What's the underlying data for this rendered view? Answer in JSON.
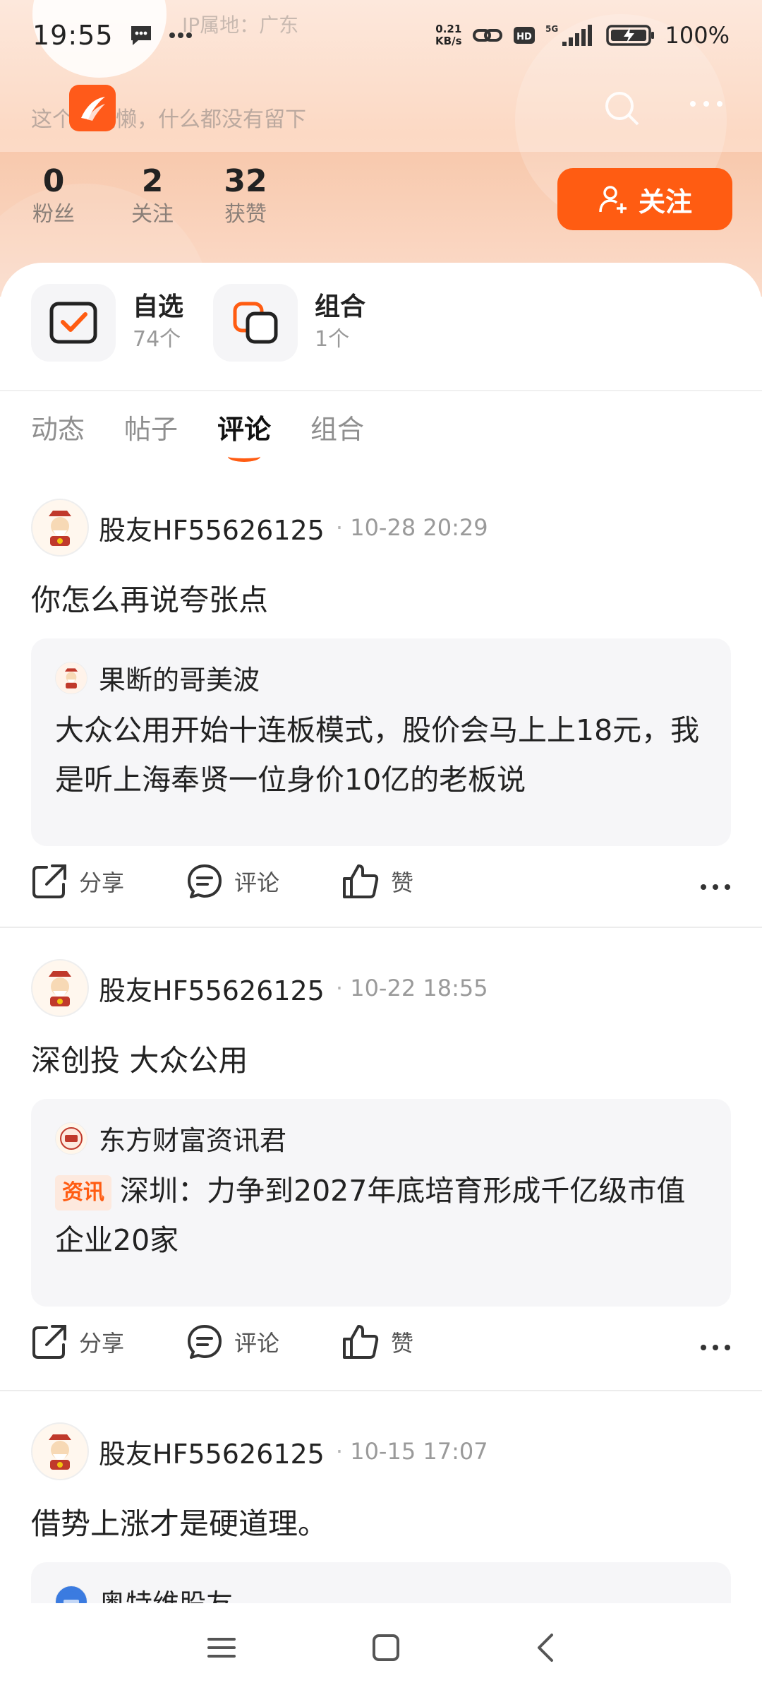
{
  "status_bar": {
    "time": "19:55",
    "net_speed_value": "0.21",
    "net_speed_unit": "KB/s",
    "battery": "100%"
  },
  "profile": {
    "ip_location": "IP属地：广东",
    "bio": "这个人很懒，什么都没有留下",
    "stats": [
      {
        "num": "0",
        "label": "粉丝"
      },
      {
        "num": "2",
        "label": "关注"
      },
      {
        "num": "32",
        "label": "获赞"
      }
    ],
    "follow_label": "关注"
  },
  "shortcuts": [
    {
      "title": "自选",
      "sub": "74个"
    },
    {
      "title": "组合",
      "sub": "1个"
    }
  ],
  "tabs": [
    {
      "label": "动态",
      "active": false
    },
    {
      "label": "帖子",
      "active": false
    },
    {
      "label": "评论",
      "active": true
    },
    {
      "label": "组合",
      "active": false
    }
  ],
  "actions": {
    "share": "分享",
    "comment": "评论",
    "like": "赞"
  },
  "posts": [
    {
      "author": "股友HF55626125",
      "time": "10-28 20:29",
      "text": "你怎么再说夸张点",
      "quote_author": "果断的哥美波",
      "quote_body": "大众公用开始十连板模式，股价会马上上18元，我是听上海奉贤一位身价10亿的老板说"
    },
    {
      "author": "股友HF55626125",
      "time": "10-22 18:55",
      "text": "深创投 大众公用",
      "quote_author": "东方财富资讯君",
      "quote_tag": "资讯",
      "quote_body": "深圳：力争到2027年底培育形成千亿级市值企业20家"
    },
    {
      "author": "股友HF55626125",
      "time": "10-15 17:07",
      "text": "借势上涨才是硬道理。",
      "quote_author": "奥特维股友"
    }
  ],
  "colors": {
    "accent": "#ff5c12",
    "header_bg": "#fcd9c4"
  }
}
